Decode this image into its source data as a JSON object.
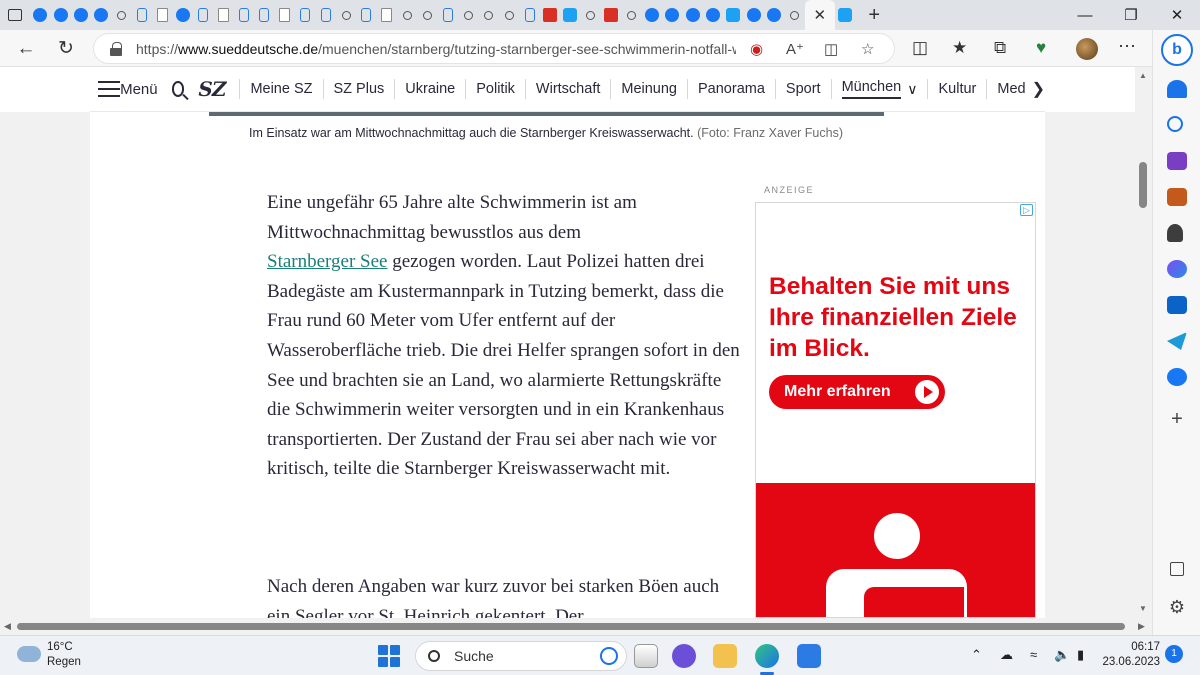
{
  "browser": {
    "url_prefix": "https://",
    "url_domain": "www.sueddeutsche.de",
    "url_path": "/muenchen/starnberg/tutzing-starnberger-see-schwimmerin-notfall-wa...",
    "active_tab_close": "✕",
    "new_tab": "+",
    "window_controls": {
      "minimize": "—",
      "restore": "❐",
      "close": "✕"
    },
    "tab_icons": [
      "fb",
      "fb",
      "fb",
      "fb",
      "search",
      "bing",
      "news",
      "fb",
      "bing",
      "circle",
      "bing",
      "bing",
      "wiki",
      "bing",
      "bing",
      "search",
      "bing",
      "doc",
      "search",
      "search",
      "bing",
      "search",
      "search",
      "search",
      "bing",
      "red",
      "tw",
      "search",
      "red",
      "search",
      "fb",
      "fb",
      "fb",
      "fb",
      "tw",
      "fb",
      "fb",
      "search"
    ]
  },
  "site_nav": {
    "menu_label": "Menü",
    "logo": "SZ",
    "items": [
      {
        "label": "Meine SZ"
      },
      {
        "label": "SZ Plus"
      },
      {
        "label": "Ukraine"
      },
      {
        "label": "Politik"
      },
      {
        "label": "Wirtschaft"
      },
      {
        "label": "Meinung"
      },
      {
        "label": "Panorama"
      },
      {
        "label": "Sport"
      },
      {
        "label": "München"
      },
      {
        "label": "Kultur"
      },
      {
        "label": "Med"
      }
    ],
    "active_item": "München"
  },
  "article": {
    "caption_text": "Im Einsatz war am Mittwochnachmittag auch die Starnberger Kreiswasserwacht.",
    "caption_credit": "(Foto: Franz Xaver Fuchs)",
    "para1_before_link": "Eine ungefähr 65 Jahre alte Schwimmerin ist am Mittwochnachmittag bewusstlos aus dem",
    "para1_link": "Starnberger See",
    "para1_after_link": "gezogen worden. Laut Polizei hatten drei Badegäste am Kustermannpark in Tutzing bemerkt, dass die Frau rund 60 Meter vom Ufer entfernt auf der Wasseroberfläche trieb. Die drei Helfer sprangen sofort in den See und brachten sie an Land, wo alarmierte Rettungskräfte die Schwimmerin weiter versorgten und in ein Krankenhaus transportierten. Der Zustand der Frau sei aber nach wie vor kritisch, teilte die Starnberger Kreiswasserwacht mit.",
    "para2": "Nach deren Angaben war kurz zuvor bei starken Böen auch ein Segler vor St. Heinrich gekentert. Der"
  },
  "ad": {
    "label": "ANZEIGE",
    "headline": "Behalten Sie mit uns Ihre finanziellen Ziele im Blick.",
    "cta": "Mehr erfahren",
    "brand_color": "#e30613"
  },
  "taskbar": {
    "weather_temp": "16°C",
    "weather_desc": "Regen",
    "search_label": "Suche",
    "time": "06:17",
    "date": "23.06.2023",
    "notifications": "1"
  }
}
